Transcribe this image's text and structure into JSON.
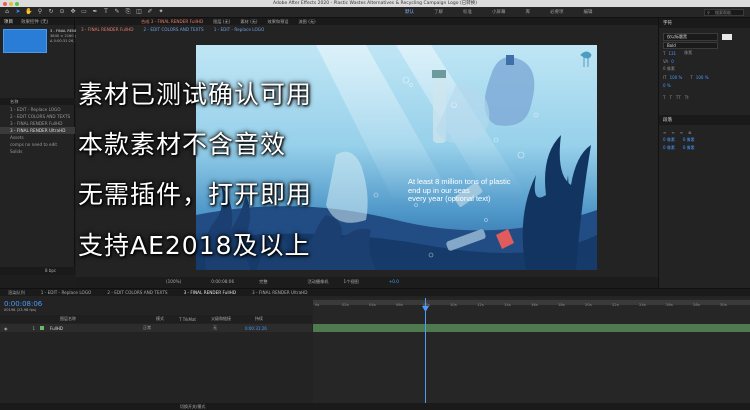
{
  "window": {
    "title": "Adobe After Effects 2020 - Plastic Wastes Alternatives & Recycling Campaign Logo (已转换)"
  },
  "workspaces": [
    "默认",
    "了解",
    "标准",
    "小屏幕",
    "库",
    "必要项",
    "编辑"
  ],
  "search": {
    "placeholder": "搜索帮助"
  },
  "project": {
    "tabs": [
      "项目",
      "效果控件 (无)"
    ],
    "selected_name": "3 - FINAL RENDER UltraHD ▾",
    "selected_info": [
      "3840 × 2160 (1.00)",
      "Δ 0:00:31:26, 23.98 fps"
    ],
    "column_header": "名称",
    "items": [
      "1 - EDIT - Replace LOGO",
      "2 - EDIT COLORS AND TEXTS",
      "3 - FINAL RENDER FullHD",
      "3 - FINAL RENDER UltraHD",
      "Assets",
      "comps no need to edit",
      "Solids"
    ],
    "footer": "8 bpc"
  },
  "viewer": {
    "panel_tabs": [
      "合成 3 - FINAL RENDER FullHD",
      "图层 (无)",
      "素材 (无)",
      "效果和预设",
      "流图 (无)"
    ],
    "breadcrumbs": [
      "3 - FINAL RENDER FullHD",
      "2 - EDIT COLORS AND TEXTS",
      "1 - EDIT - Replace LOGO"
    ],
    "scene_text": [
      "At least 8 million tons of plastic",
      "end up in our seas",
      "every year (optional text)"
    ],
    "footer": {
      "zoom": "(100%)",
      "time": "0:00:08:06",
      "quality": "完整",
      "camera": "活动摄像机",
      "views": "1个视图",
      "exposure": "+0.0"
    }
  },
  "right_panel": {
    "character_title": "字符",
    "font": "仅以标题黑",
    "font_style": "Bold",
    "size_label": "像素",
    "size_value": "131",
    "tracking_value": "0",
    "scale_values": [
      "100 %",
      "100 %"
    ],
    "baseline": "0 像素",
    "tsume": "0 %",
    "paragraph_title": "段落",
    "indent_values": [
      "0 像素",
      "0 像素",
      "0 像素",
      "0 像素"
    ]
  },
  "timeline": {
    "tabs": [
      "渲染队列",
      "1 - EDIT - Replace LOGO",
      "2 - EDIT COLORS AND TEXTS",
      "3 - FINAL RENDER FullHD",
      "3 - FINAL RENDER UltraHD"
    ],
    "timecode": "0:00:08:06",
    "timecode_sub": "00198 (23.98 fps)",
    "columns": [
      "图层名称",
      "模式",
      "T TrkMat",
      "父级和链接",
      "持续"
    ],
    "layer": {
      "num": "1",
      "name": "FullHD",
      "mode": "正常",
      "parent": "无",
      "duration": "0:00:31:26"
    },
    "ruler": [
      "0s",
      "02s",
      "04s",
      "06s",
      "08s",
      "10s",
      "12s",
      "14s",
      "16s",
      "18s",
      "20s",
      "22s",
      "24s",
      "26s",
      "28s",
      "30s"
    ],
    "footer": "切换开关/模式"
  },
  "captions": [
    "素材已测试确认可用",
    "本款素材不含音效",
    "无需插件，打开即用",
    "支持AE2018及以上"
  ],
  "colors": {
    "accent": "#2d8ceb",
    "comp_tab": "#e57b6a",
    "playhead": "#4a9bff",
    "track": "#4f7a4f"
  }
}
